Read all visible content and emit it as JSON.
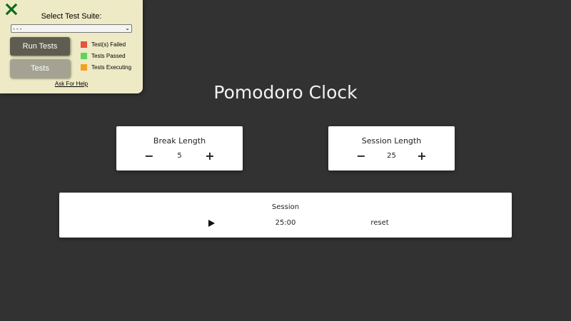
{
  "test_panel": {
    "title": "Select Test Suite:",
    "select_value": "- - -",
    "run_button": "Run Tests",
    "tests_button": "Tests",
    "legend": [
      {
        "label": "Test(s) Failed",
        "color": "#e8533c"
      },
      {
        "label": "Tests Passed",
        "color": "#5fd35a"
      },
      {
        "label": "Tests Executing",
        "color": "#f5a020"
      }
    ],
    "help_link": "Ask For Help",
    "close_icon": "close-x-icon",
    "close_color": "#0c6b1c"
  },
  "app": {
    "title": "Pomodoro Clock",
    "break": {
      "label": "Break Length",
      "value": "5",
      "decrement": "−",
      "increment": "+"
    },
    "session": {
      "label": "Session Length",
      "value": "25",
      "decrement": "−",
      "increment": "+"
    },
    "timer": {
      "label": "Session",
      "time": "25:00",
      "reset": "reset",
      "play_icon": "play-icon"
    }
  }
}
